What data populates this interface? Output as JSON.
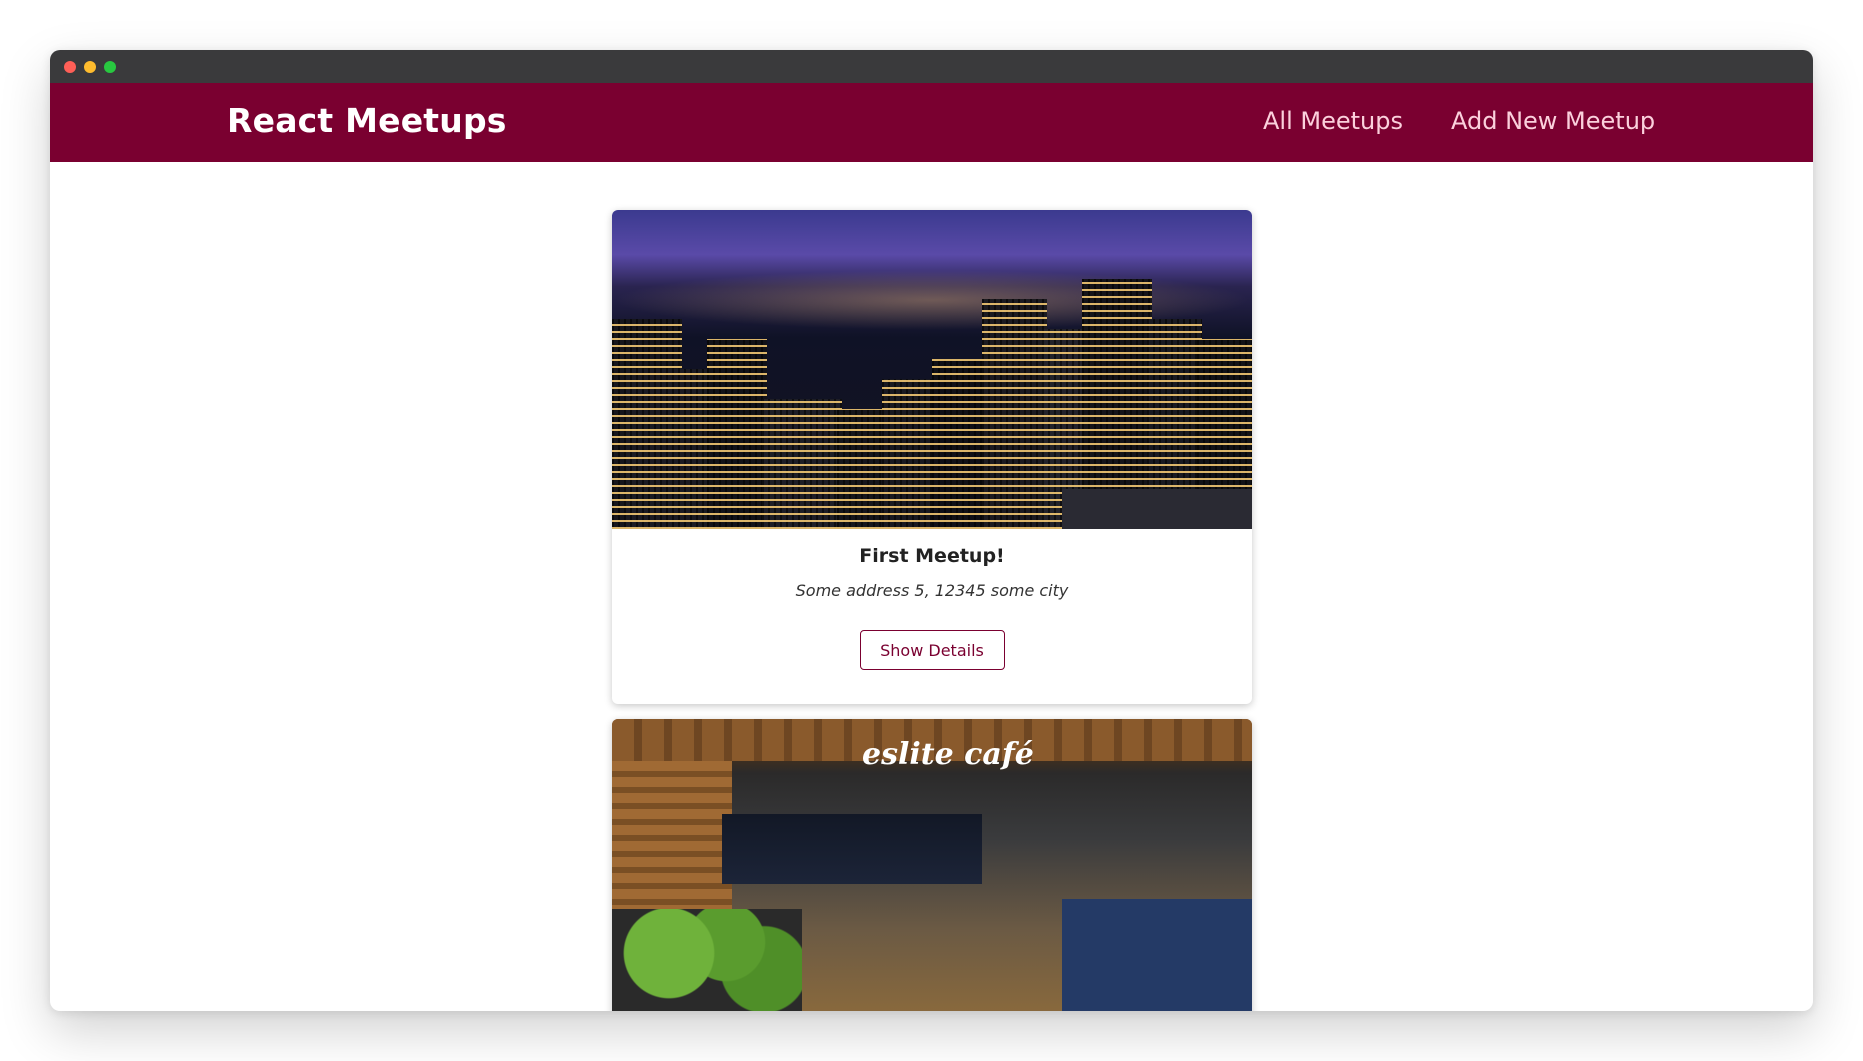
{
  "window": {
    "controls": [
      "close",
      "minimize",
      "zoom"
    ]
  },
  "header": {
    "brand": "React Meetups",
    "nav": [
      {
        "label": "All Meetups"
      },
      {
        "label": "Add New Meetup"
      }
    ]
  },
  "meetups": [
    {
      "title": "First Meetup!",
      "address": "Some address 5, 12345 some city",
      "action_label": "Show Details",
      "image": "city-skyline-at-night"
    },
    {
      "image": "eslite-cafe-interior",
      "image_sign": "eslite café"
    }
  ],
  "colors": {
    "brand": "#7a0030",
    "nav_text": "#fbd0dc",
    "titlebar": "#3a3a3c"
  }
}
